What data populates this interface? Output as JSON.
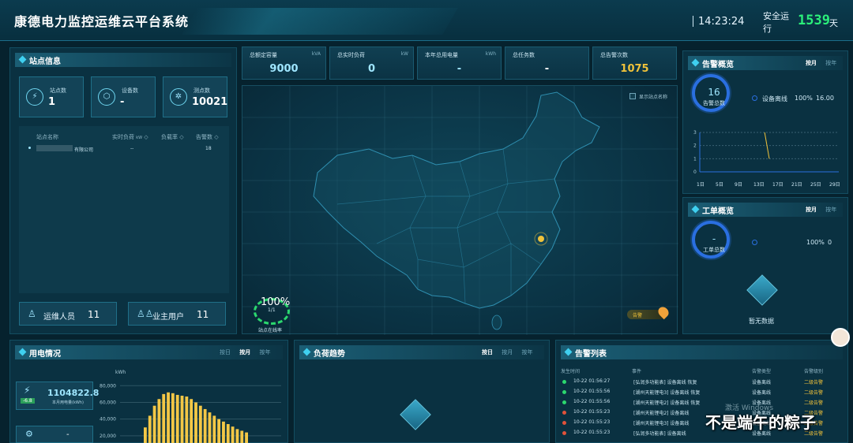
{
  "header": {
    "title": "康德电力监控运维云平台系统",
    "time": "14:23:24",
    "safe_label": "安全运行",
    "safe_days": "1539",
    "safe_unit": "天"
  },
  "station": {
    "title": "站点信息",
    "stats": [
      {
        "label": "站点数",
        "value": "1",
        "icon": "station-icon"
      },
      {
        "label": "设备数",
        "value": "-",
        "icon": "device-icon"
      },
      {
        "label": "测点数",
        "value": "10021",
        "icon": "point-icon"
      }
    ],
    "table": {
      "headers": [
        "站点名称",
        "实时负荷",
        "负载率",
        "告警数"
      ],
      "header_units": [
        "",
        "kW",
        "",
        ""
      ],
      "rows": [
        {
          "name": "有限公司",
          "load": "--",
          "rate": "",
          "alarms": "18"
        }
      ]
    },
    "people": [
      {
        "label": "运维人员",
        "value": "11",
        "icon": "person-icon"
      },
      {
        "label": "业主用户",
        "value": "11",
        "icon": "users-icon"
      }
    ]
  },
  "kpis": [
    {
      "label": "总额定容量",
      "unit": "kVA",
      "value": "9000",
      "color": "#9fe6ff"
    },
    {
      "label": "总实时负荷",
      "unit": "kW",
      "value": "0",
      "color": "#9fe6ff"
    },
    {
      "label": "本年总用电量",
      "unit": "kWh",
      "value": "-",
      "color": "#9fe6ff"
    },
    {
      "label": "总任务数",
      "unit": "",
      "value": "-",
      "color": "#ffffff"
    },
    {
      "label": "总告警次数",
      "unit": "",
      "value": "1075",
      "color": "#f0c23a"
    }
  ],
  "map": {
    "show_names_label": "显示站点名称",
    "online_percent": "100%",
    "online_ratio": "1/1",
    "online_label": "站点在线率",
    "alarm_tag": "告警"
  },
  "alarm_overview": {
    "title": "告警概览",
    "tabs": [
      "按月",
      "按年"
    ],
    "total": "16",
    "total_label": "告警总数",
    "legend": {
      "label": "设备离线",
      "percent": "100%",
      "count": "16.00"
    },
    "chart_data": {
      "type": "line",
      "x_ticks": [
        "1日",
        "5日",
        "9日",
        "13日",
        "17日",
        "21日",
        "25日",
        "29日"
      ],
      "y_ticks": [
        "0",
        "1",
        "2",
        "3"
      ],
      "ylim": [
        0,
        3
      ],
      "series": [
        {
          "x": [
            15,
            16
          ],
          "values": [
            3,
            1
          ]
        }
      ]
    }
  },
  "work_overview": {
    "title": "工单概览",
    "tabs": [
      "按月",
      "按年"
    ],
    "total": "-",
    "total_label": "工单总数",
    "legend": {
      "percent": "100%",
      "count": "0"
    },
    "empty_label": "暂无数据"
  },
  "power": {
    "title": "用电情况",
    "tabs": [
      "按日",
      "按月",
      "按年"
    ],
    "value": "1104822.8",
    "value_label": "本月用电量(kWh)",
    "badge": "-6.8",
    "second_value": "-",
    "chart_data": {
      "type": "bar",
      "ylabel": "kWh",
      "y_ticks": [
        "80,000",
        "60,000",
        "40,000",
        "20,000"
      ],
      "ylim": [
        0,
        80000
      ],
      "values": [
        30000,
        44000,
        56000,
        64000,
        70000,
        72000,
        71000,
        69000,
        68000,
        67000,
        64000,
        60000,
        56000,
        52000,
        48000,
        44000,
        40000,
        37000,
        34000,
        31000,
        28000,
        26000,
        24000
      ]
    }
  },
  "load_trend": {
    "title": "负荷趋势",
    "tabs": [
      "按日",
      "按月",
      "按年"
    ]
  },
  "alarm_list": {
    "title": "告警列表",
    "headers": [
      "发生时间",
      "事件",
      "告警类型",
      "告警级别"
    ],
    "rows": [
      {
        "status": "g",
        "time": "10-22 01:56:27",
        "event": "[弘润多功能表] 设备离线 恢复",
        "type": "设备离线",
        "level": "二级告警"
      },
      {
        "status": "g",
        "time": "10-22 01:55:56",
        "event": "[湖州天能锂电3] 设备离线 恢复",
        "type": "设备离线",
        "level": "二级告警"
      },
      {
        "status": "g",
        "time": "10-22 01:55:56",
        "event": "[湖州天能锂电2] 设备离线 恢复",
        "type": "设备离线",
        "level": "二级告警"
      },
      {
        "status": "r",
        "time": "10-22 01:55:23",
        "event": "[湖州天能锂电2] 设备离线",
        "type": "设备离线",
        "level": "二级告警"
      },
      {
        "status": "r",
        "time": "10-22 01:55:23",
        "event": "[湖州天能锂电3] 设备离线",
        "type": "设备离线",
        "level": "二级告警"
      },
      {
        "status": "r",
        "time": "10-22 01:55:23",
        "event": "[弘润多功能表] 设备离线",
        "type": "设备离线",
        "level": "二级告警"
      }
    ]
  },
  "overlay": {
    "watermark": "激活 Windows",
    "caption": "不是端午的粽子"
  }
}
